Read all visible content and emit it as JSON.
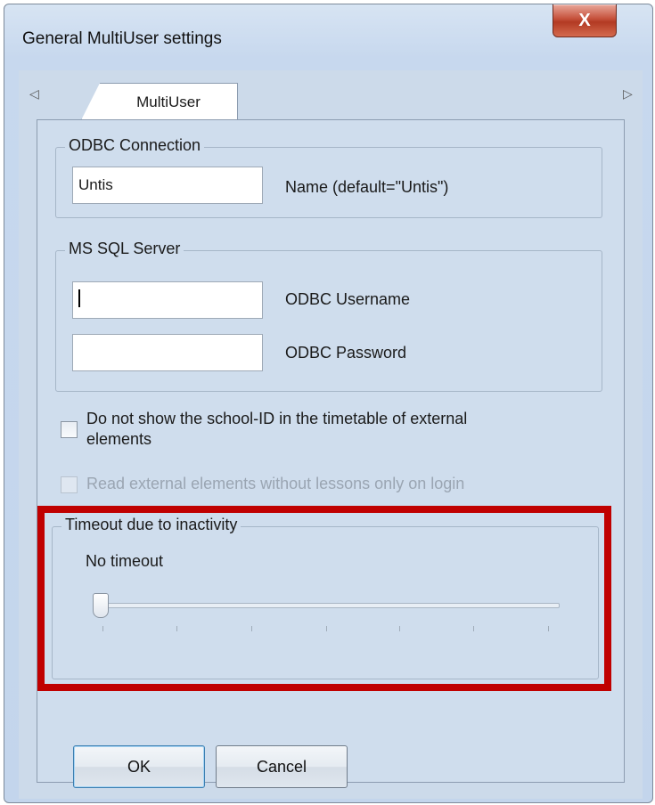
{
  "window": {
    "title": "General MultiUser settings",
    "close_glyph": "X"
  },
  "tabs": {
    "left_arrow": "◁",
    "right_arrow": "▷",
    "active_label": "MultiUser"
  },
  "odbc_connection": {
    "legend": "ODBC Connection",
    "name_value": "Untis",
    "name_label": "Name (default=\"Untis\")"
  },
  "ms_sql_server": {
    "legend": "MS SQL Server",
    "username_value": "",
    "username_label": "ODBC Username",
    "password_value": "",
    "password_label": "ODBC Password"
  },
  "options": {
    "hide_school_id_line1": "Do not show the school-ID in the timetable of external",
    "hide_school_id_line2": "elements",
    "hide_school_id_checked": false,
    "read_external_label": "Read external elements without lessons only on login",
    "read_external_checked": false,
    "read_external_enabled": false
  },
  "timeout": {
    "legend": "Timeout due to inactivity",
    "value_label": "No timeout",
    "slider_position": 0,
    "slider_steps": 7
  },
  "buttons": {
    "ok": "OK",
    "cancel": "Cancel"
  },
  "colors": {
    "highlight": "#c00000",
    "close_button": "#c5503a"
  },
  "icons": {
    "close": "close-icon",
    "tab_left": "triangle-left-icon",
    "tab_right": "triangle-right-icon"
  }
}
